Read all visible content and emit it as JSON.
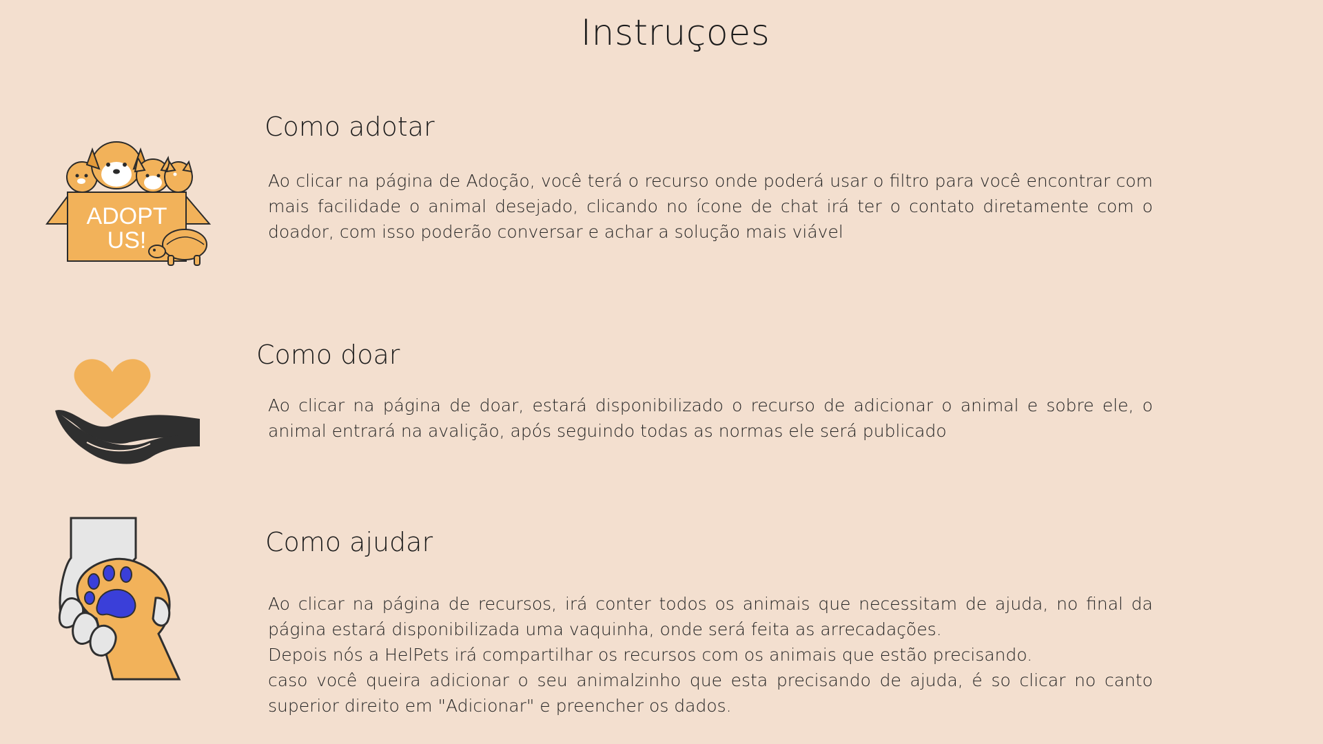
{
  "page": {
    "title": "Instruçoes"
  },
  "sections": [
    {
      "title": "Como adotar",
      "paragraphs": [
        "Ao clicar na página de Adoção, você terá o recurso onde poderá usar o filtro para você encontrar com mais facilidade o animal desejado, clicando no ícone de chat irá ter o contato diretamente com o doador, com isso poderão conversar e achar a solução mais viável"
      ],
      "icon": "adopt-box-icon",
      "box_text_line1": "ADOPT",
      "box_text_line2": "US!"
    },
    {
      "title": "Como doar",
      "paragraphs": [
        "Ao clicar na página de doar, estará disponibilizado o recurso de adicionar o animal e sobre ele, o animal entrará na avalição, após seguindo todas as normas ele será publicado"
      ],
      "icon": "heart-hand-icon"
    },
    {
      "title": "Como ajudar",
      "paragraphs": [
        "Ao clicar na página de recursos, irá conter todos os animais que necessitam de ajuda, no final da página estará disponibilizada uma vaquinha, onde será feita as arrecadações.",
        "Depois nós a HelPets irá compartilhar os recursos com os animais que estão precisando.",
        "caso você queira adicionar o seu animalzinho que esta precisando de ajuda, é so clicar no canto superior direito em \"Adicionar\" e preencher os dados."
      ],
      "icon": "hand-paw-icon"
    }
  ],
  "colors": {
    "background": "#f3dfcf",
    "accent_orange": "#f2b25a",
    "dark": "#2f2f2f",
    "paw_blue": "#3a3fd9"
  }
}
